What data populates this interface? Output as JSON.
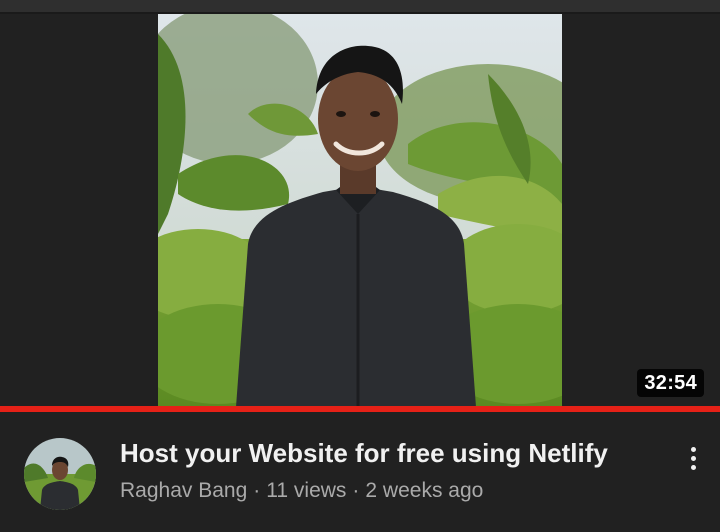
{
  "video": {
    "duration": "32:54",
    "title": "Host your Website for free using Netlify",
    "channel": "Raghav Bang",
    "views": "11 views",
    "age": "2 weeks ago",
    "separator": "·",
    "progress_fraction": 1.0
  },
  "icons": {
    "more": "more-vertical-icon"
  },
  "colors": {
    "background": "#212121",
    "progress": "#e62117",
    "title": "#f1f1f1",
    "subtext": "#aaaaaa"
  }
}
